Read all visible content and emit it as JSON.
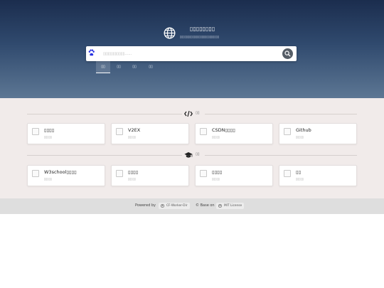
{
  "header": {
    "title": "▯▯▯▯▯▯▯▯",
    "subtitle": "▯▯▯▯▯▯▯▯▯▯▯▯▯▯▯▯▯▯▯▯▯▯▯▯▯",
    "logo_icon": "globe-icon"
  },
  "search": {
    "engine_icon": "baidu-paw-icon",
    "placeholder": "▯▯▯▯▯▯▯▯▯▯▯……",
    "value": "",
    "button_icon": "search-icon",
    "tabs": [
      {
        "label": "▯▯",
        "active": true
      },
      {
        "label": "▯▯",
        "active": false
      },
      {
        "label": "▯▯",
        "active": false
      },
      {
        "label": "▯▯",
        "active": false
      }
    ]
  },
  "sections": [
    {
      "icon": "code-icon",
      "title": "▯▯",
      "cards": [
        {
          "name": "▯▯▯▯",
          "desc": "▯▯▯▯▯"
        },
        {
          "name": "V2EX",
          "desc": "▯▯▯▯▯"
        },
        {
          "name": "CSDN▯▯▯▯",
          "desc": "▯▯▯▯▯"
        },
        {
          "name": "Github",
          "desc": "▯▯▯▯▯"
        }
      ]
    },
    {
      "icon": "graduation-cap-icon",
      "title": "▯▯",
      "cards": [
        {
          "name": "W3school▯▯▯▯",
          "desc": "▯▯▯▯▯"
        },
        {
          "name": "▯▯▯▯",
          "desc": "▯▯▯▯▯"
        },
        {
          "name": "▯▯▯▯",
          "desc": "▯▯▯▯▯"
        },
        {
          "name": "▯▯",
          "desc": "▯▯▯▯▯"
        }
      ]
    }
  ],
  "footer": {
    "powered_by": "Powered by",
    "project_badge": "CF-Worker-Dir",
    "project_icon": "github-icon",
    "base_on": "© Base on",
    "license_badge": "MIT License",
    "license_icon": "github-icon"
  },
  "colors": {
    "header_top": "#1b2d4e",
    "header_bottom": "#5d7794",
    "content_bg": "#f1ebea",
    "footer_bg": "#dedede",
    "baidu_blue": "#2932e1"
  }
}
